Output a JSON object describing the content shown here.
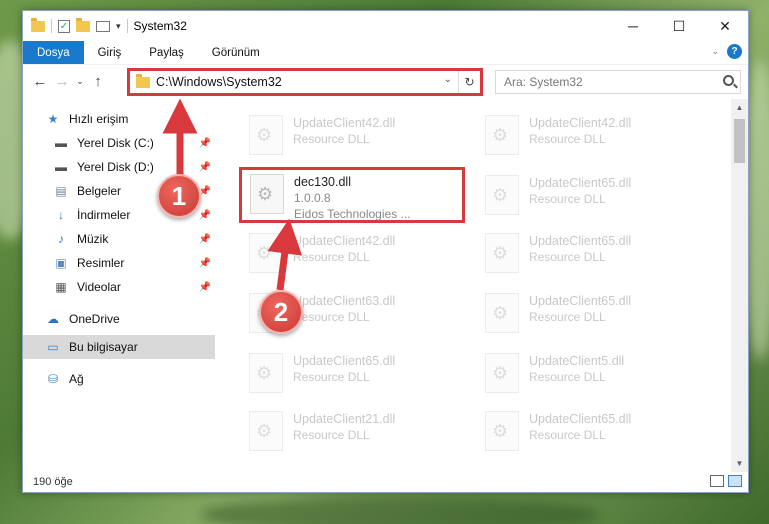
{
  "window": {
    "title": "System32",
    "controls": {
      "minimize": "─",
      "maximize": "☐",
      "close": "✕"
    }
  },
  "ribbon": {
    "tabs": [
      "Dosya",
      "Giriş",
      "Paylaş",
      "Görünüm"
    ],
    "active_tab": "Dosya"
  },
  "address_bar": {
    "path": "C:\\Windows\\System32",
    "refresh": "↻"
  },
  "search": {
    "placeholder": "Ara: System32"
  },
  "sidebar": {
    "quick_access": "Hızlı erişim",
    "items": [
      {
        "label": "Yerel Disk (C:)",
        "icon": "drive-icon",
        "pinned": true
      },
      {
        "label": "Yerel Disk (D:)",
        "icon": "drive-icon",
        "pinned": true
      },
      {
        "label": "Belgeler",
        "icon": "documents-icon",
        "pinned": true
      },
      {
        "label": "İndirmeler",
        "icon": "download-icon",
        "pinned": true
      },
      {
        "label": "Müzik",
        "icon": "music-icon",
        "pinned": true
      },
      {
        "label": "Resimler",
        "icon": "pictures-icon",
        "pinned": true
      },
      {
        "label": "Videolar",
        "icon": "video-icon",
        "pinned": true
      }
    ],
    "onedrive": "OneDrive",
    "this_pc": "Bu bilgisayar",
    "network": "Ağ"
  },
  "files": {
    "left_column": [
      {
        "name": "UpdateClient42.dll",
        "sub": "Resource DLL"
      },
      {
        "name": "dec130.dll",
        "sub": "1.0.0.8",
        "sub2": "Eidos Technologies ..."
      },
      {
        "name": "UpdateClient42.dll",
        "sub": "Resource DLL"
      },
      {
        "name": "UpdateClient63.dll",
        "sub": "Resource DLL"
      },
      {
        "name": "UpdateClient65.dll",
        "sub": "Resource DLL"
      },
      {
        "name": "UpdateClient21.dll",
        "sub": "Resource DLL"
      }
    ],
    "right_column": [
      {
        "name": "UpdateClient42.dll",
        "sub": "Resource DLL"
      },
      {
        "name": "UpdateClient65.dll",
        "sub": "Resource DLL"
      },
      {
        "name": "UpdateClient65.dll",
        "sub": "Resource DLL"
      },
      {
        "name": "UpdateClient65.dll",
        "sub": "Resource DLL"
      },
      {
        "name": "UpdateClient5.dll",
        "sub": "Resource DLL"
      },
      {
        "name": "UpdateClient65.dll",
        "sub": "Resource DLL"
      }
    ]
  },
  "status": {
    "count": "190 öğe"
  },
  "annotations": {
    "badge1": "1",
    "badge2": "2",
    "color": "#d9393c"
  }
}
